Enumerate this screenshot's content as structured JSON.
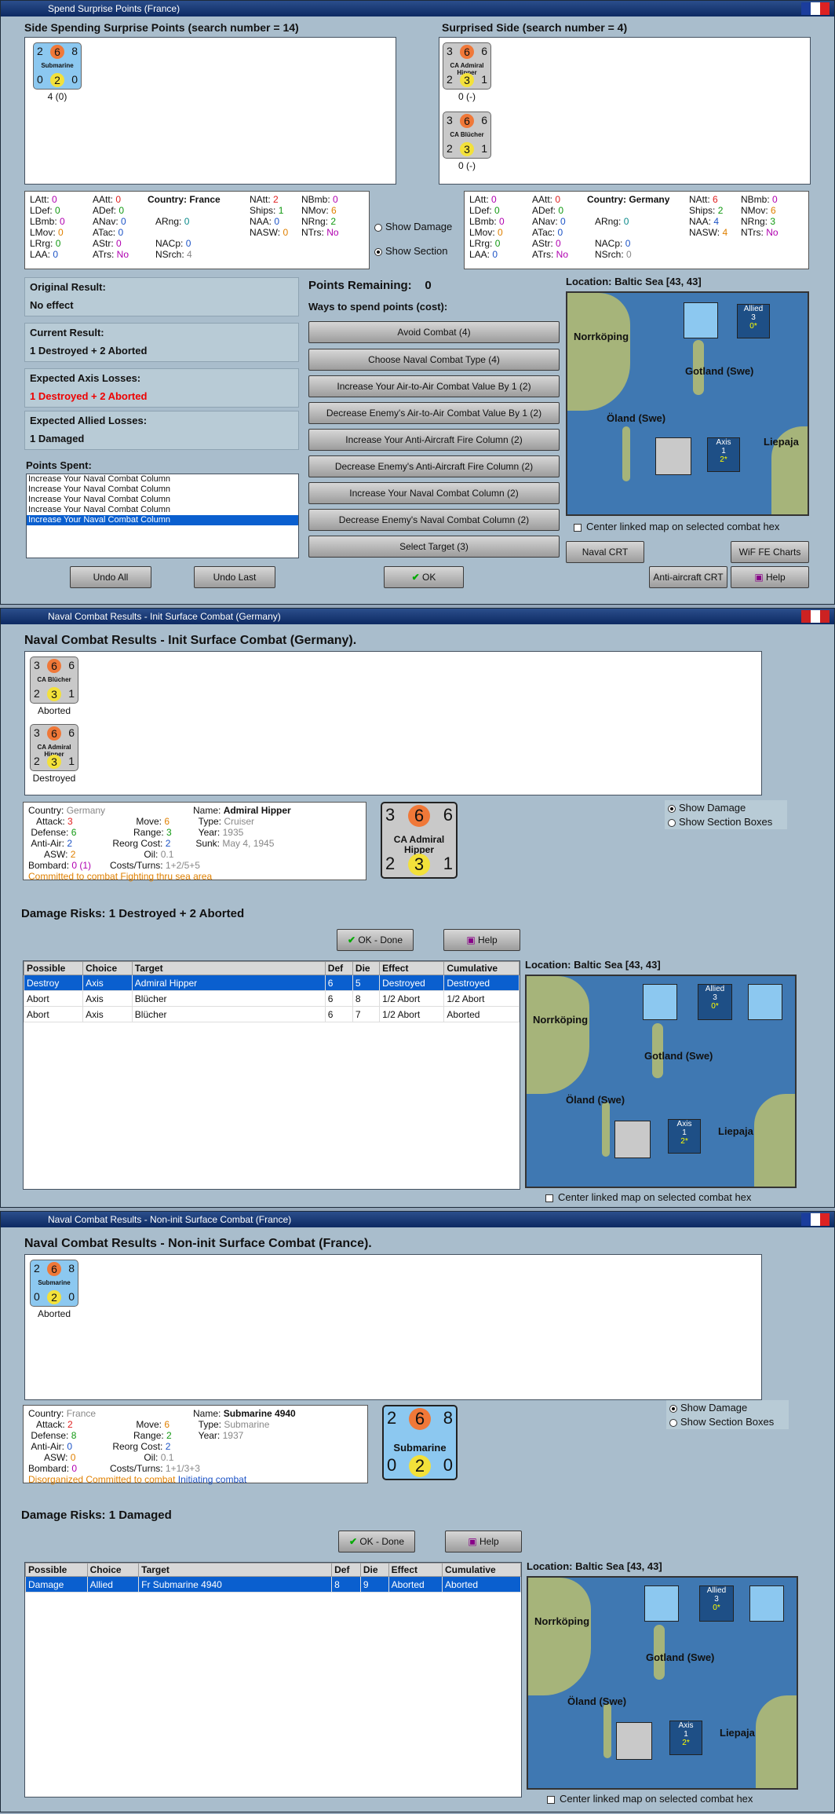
{
  "colors": {
    "accent": "#0a5fcf",
    "loss": "#e00000"
  },
  "w1": {
    "title": "Spend Surprise Points (France)",
    "left_header": "Side Spending Surprise Points (search number = 14)",
    "right_header": "Surprised Side (search number = 4)",
    "left_unit": {
      "top": [
        "2",
        "6",
        "8"
      ],
      "name": "Submarine",
      "bottom": [
        "0",
        "2",
        "0"
      ],
      "caption": "4 (0)"
    },
    "right_units": [
      {
        "top": [
          "3",
          "6",
          "6"
        ],
        "name": "CA Admiral Hipper",
        "bottom": [
          "2",
          "3",
          "1"
        ],
        "caption": "0 (-)"
      },
      {
        "top": [
          "3",
          "6",
          "6"
        ],
        "name": "CA Blücher",
        "bottom": [
          "2",
          "3",
          "1"
        ],
        "caption": "0 (-)"
      }
    ],
    "stats_left": {
      "country_label": "Country:",
      "country": "France",
      "rows": [
        [
          "LAtt:",
          "0",
          "AAtt:",
          "0",
          "NAtt:",
          "2",
          "NBmb:",
          "0"
        ],
        [
          "LDef:",
          "0",
          "ADef:",
          "0",
          "Ships:",
          "1",
          "NMov:",
          "6"
        ],
        [
          "LBmb:",
          "0",
          "ANav:",
          "0",
          "ARng:",
          "0",
          "NAA:",
          "0",
          "NRng:",
          "2"
        ],
        [
          "LMov:",
          "0",
          "ATac:",
          "0",
          "",
          "",
          "NASW:",
          "0",
          "NTrs:",
          "No"
        ],
        [
          "LRrg:",
          "0",
          "AStr:",
          "0",
          "NACp:",
          "0",
          "",
          ""
        ],
        [
          "LAA:",
          "0",
          "ATrs:",
          "No",
          "NSrch:",
          "4",
          "",
          ""
        ]
      ]
    },
    "stats_right": {
      "country_label": "Country:",
      "country": "Germany",
      "rows": [
        [
          "LAtt:",
          "0",
          "AAtt:",
          "0",
          "NAtt:",
          "6",
          "NBmb:",
          "0"
        ],
        [
          "LDef:",
          "0",
          "ADef:",
          "0",
          "Ships:",
          "2",
          "NMov:",
          "6"
        ],
        [
          "LBmb:",
          "0",
          "ANav:",
          "0",
          "ARng:",
          "0",
          "NAA:",
          "4",
          "NRng:",
          "3"
        ],
        [
          "LMov:",
          "0",
          "ATac:",
          "0",
          "",
          "",
          "NASW:",
          "4",
          "NTrs:",
          "No"
        ],
        [
          "LRrg:",
          "0",
          "AStr:",
          "0",
          "NACp:",
          "0",
          "",
          ""
        ],
        [
          "LAA:",
          "0",
          "ATrs:",
          "No",
          "NSrch:",
          "0",
          "",
          ""
        ]
      ]
    },
    "show_damage": "Show Damage",
    "show_section": "Show Section",
    "original_result_label": "Original Result:",
    "original_result": "No effect",
    "current_result_label": "Current Result:",
    "current_result": "1 Destroyed + 2 Aborted",
    "axis_losses_label": "Expected Axis Losses:",
    "axis_losses": "1 Destroyed + 2 Aborted",
    "allied_losses_label": "Expected Allied Losses:",
    "allied_losses": "1 Damaged",
    "points_spent_label": "Points Spent:",
    "points_spent": [
      "Increase Your Naval Combat Column",
      "Increase Your Naval Combat Column",
      "Increase Your Naval Combat Column",
      "Increase Your Naval Combat Column",
      "Increase Your Naval Combat Column"
    ],
    "points_remaining_label": "Points Remaining:",
    "points_remaining": "0",
    "ways_label": "Ways to spend points (cost):",
    "ways": [
      "Avoid Combat (4)",
      "Choose Naval Combat Type (4)",
      "Increase Your Air-to-Air Combat Value By 1 (2)",
      "Decrease Enemy's Air-to-Air Combat Value By 1 (2)",
      "Increase Your Anti-Aircraft Fire Column (2)",
      "Decrease Enemy's Anti-Aircraft Fire Column (2)",
      "Increase Your Naval Combat Column (2)",
      "Decrease Enemy's Naval Combat Column (2)",
      "Select Target (3)"
    ],
    "location": "Location: Baltic Sea [43, 43]",
    "center_map": "Center linked map on selected combat hex",
    "naval_crt": "Naval CRT",
    "wif_charts": "WiF FE Charts",
    "anti_crt": "Anti-aircraft CRT",
    "help": "Help",
    "undo_all": "Undo All",
    "undo_last": "Undo Last",
    "ok": "OK"
  },
  "map": {
    "norrkoping": "Norrköping",
    "gotland": "Gotland (Swe)",
    "oland": "Öland (Swe)",
    "liepaja": "Liepaja",
    "allied": "Allied",
    "allied_num": "3",
    "allied_sub": "0*",
    "axis": "Axis",
    "axis_num": "1",
    "axis_sub": "2*",
    "stack_count": "2"
  },
  "w2": {
    "title": "Naval Combat Results - Init Surface Combat (Germany)",
    "header": "Naval Combat Results - Init Surface Combat (Germany).",
    "units": [
      {
        "top": [
          "3",
          "6",
          "6"
        ],
        "name": "CA Blücher",
        "bottom": [
          "2",
          "3",
          "1"
        ],
        "caption": "Aborted"
      },
      {
        "top": [
          "3",
          "6",
          "6"
        ],
        "name": "CA Admiral Hipper",
        "bottom": [
          "2",
          "3",
          "1"
        ],
        "caption": "Destroyed"
      }
    ],
    "info": {
      "country": "Germany",
      "attack": "3",
      "defense": "6",
      "anti_air": "2",
      "asw": "2",
      "bombard": "0 (1)",
      "move": "6",
      "range": "3",
      "reorg": "2",
      "oil": "0.1",
      "costs": "1+2/5+5",
      "name": "Admiral Hipper",
      "type": "Cruiser",
      "year": "1935",
      "sunk": "May 4, 1945",
      "status": "Committed to combat Fighting thru sea area"
    },
    "big_unit": {
      "top": [
        "3",
        "6",
        "6"
      ],
      "name": "CA Admiral Hipper",
      "bottom": [
        "2",
        "3",
        "1"
      ]
    },
    "show_damage": "Show Damage",
    "show_sections": "Show Section Boxes",
    "damage_risks": "Damage Risks: 1 Destroyed + 2 Aborted",
    "ok_done": "OK - Done",
    "help": "Help",
    "columns": [
      "Possible",
      "Choice",
      "Target",
      "Def",
      "Die",
      "Effect",
      "Cumulative"
    ],
    "rows": [
      [
        "Destroy",
        "Axis",
        "Admiral Hipper",
        "6",
        "5",
        "Destroyed",
        "Destroyed"
      ],
      [
        "Abort",
        "Axis",
        "Blücher",
        "6",
        "8",
        "1/2 Abort",
        "1/2 Abort"
      ],
      [
        "Abort",
        "Axis",
        "Blücher",
        "6",
        "7",
        "1/2 Abort",
        "Aborted"
      ]
    ],
    "location": "Location:  Baltic Sea [43, 43]",
    "center_map": "Center linked map on selected combat hex"
  },
  "w3": {
    "title": "Naval Combat Results - Non-init Surface Combat (France)",
    "header": "Naval Combat Results - Non-init Surface Combat (France).",
    "units": [
      {
        "top": [
          "2",
          "6",
          "8"
        ],
        "name": "Submarine",
        "bottom": [
          "0",
          "2",
          "0"
        ],
        "caption": "Aborted"
      }
    ],
    "info": {
      "country": "France",
      "attack": "2",
      "defense": "8",
      "anti_air": "0",
      "asw": "0",
      "bombard": "0",
      "move": "6",
      "range": "2",
      "reorg": "2",
      "oil": "0.1",
      "costs": "1+1/3+3",
      "name": "Submarine 4940",
      "type": "Submarine",
      "year": "1937",
      "status_a": "Disorganized",
      "status_b": "Committed to combat",
      "status_c": "Initiating combat"
    },
    "big_unit": {
      "top": [
        "2",
        "6",
        "8"
      ],
      "name": "Submarine",
      "bottom": [
        "0",
        "2",
        "0"
      ]
    },
    "show_damage": "Show Damage",
    "show_sections": "Show Section Boxes",
    "damage_risks": "Damage Risks:  1 Damaged",
    "ok_done": "OK - Done",
    "help": "Help",
    "columns": [
      "Possible",
      "Choice",
      "Target",
      "Def",
      "Die",
      "Effect",
      "Cumulative"
    ],
    "rows": [
      [
        "Damage",
        "Allied",
        "Fr Submarine 4940",
        "8",
        "9",
        "Aborted",
        "Aborted"
      ]
    ],
    "location": "Location:  Baltic Sea [43, 43]",
    "center_map": "Center linked map on selected combat hex"
  }
}
